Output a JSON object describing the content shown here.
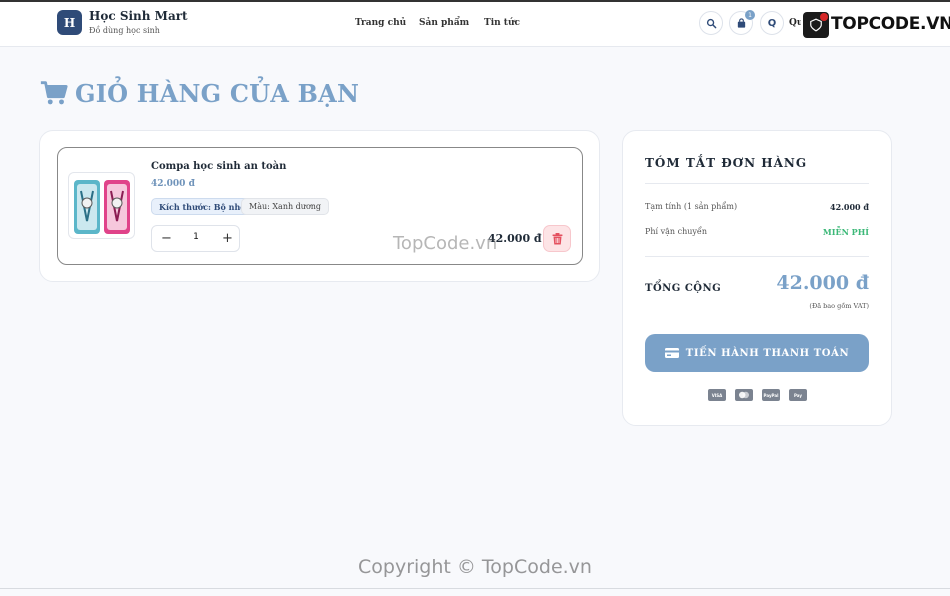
{
  "header": {
    "logo_letter": "H",
    "brand_name": "Học Sinh Mart",
    "brand_tagline": "Đồ dùng học sinh",
    "nav": [
      "Trang chủ",
      "Sản phẩm",
      "Tin tức"
    ],
    "cart_count": "1",
    "avatar_letter": "Q",
    "user_name_partial": "Qu"
  },
  "watermark": {
    "logo_text": "TOPCODE.VN",
    "overlay_text": "TopCode.vn",
    "copyright": "Copyright © TopCode.vn"
  },
  "page": {
    "title": "GIỎ HÀNG CỦA BẠN"
  },
  "cart": {
    "items": [
      {
        "name": "Compa học sinh an toàn",
        "price": "42.000 đ",
        "size_tag": "Kích thước: Bộ nhỏ",
        "color_tag": "Màu: Xanh dương",
        "quantity": "1",
        "line_total": "42.000 đ"
      }
    ]
  },
  "summary": {
    "title": "TÓM TẮT ĐƠN HÀNG",
    "subtotal_label": "Tạm tính (1 sản phẩm)",
    "subtotal_value": "42.000 đ",
    "shipping_label": "Phí vận chuyển",
    "shipping_value": "MIỄN PHÍ",
    "total_label": "TỔNG CỘNG",
    "total_value": "42.000 đ",
    "vat_note": "(Đã bao gồm VAT)",
    "checkout_label": "TIẾN HÀNH THANH TOÁN",
    "payment_icons": [
      "VISA",
      "MC",
      "PayPal",
      "Pay"
    ]
  },
  "colors": {
    "accent": "#7aa1c8",
    "brand_dark": "#2f4b78",
    "free_green": "#3cb878",
    "delete_bg": "#fde4e6"
  }
}
